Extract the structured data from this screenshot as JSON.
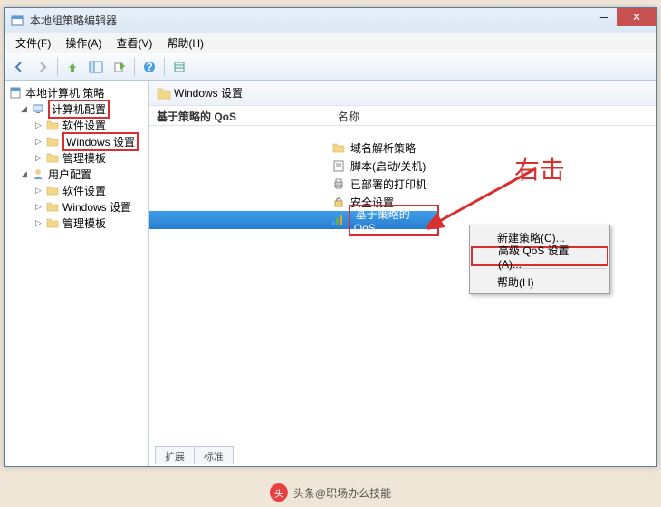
{
  "window": {
    "title": "本地组策略编辑器"
  },
  "menubar": [
    "文件(F)",
    "操作(A)",
    "查看(V)",
    "帮助(H)"
  ],
  "tree": {
    "root": "本地计算机 策略",
    "computer_config": "计算机配置",
    "software_settings": "软件设置",
    "windows_settings": "Windows 设置",
    "admin_templates": "管理模板",
    "user_config": "用户配置",
    "software_settings2": "软件设置",
    "windows_settings2": "Windows 设置",
    "admin_templates2": "管理模板"
  },
  "location": {
    "label": "Windows 设置"
  },
  "columns": {
    "section_title": "基于策略的 QoS",
    "name": "名称"
  },
  "list": [
    {
      "label": "域名解析策略",
      "icon": "folder"
    },
    {
      "label": "脚本(启动/关机)",
      "icon": "script"
    },
    {
      "label": "已部署的打印机",
      "icon": "printer"
    },
    {
      "label": "安全设置",
      "icon": "lock"
    },
    {
      "label": "基于策略的 QoS",
      "icon": "qos",
      "selected": true,
      "highlight": true
    }
  ],
  "context_menu": {
    "new_policy": "新建策略(C)...",
    "advanced": "高级 QoS 设置(A)...",
    "help": "帮助(H)"
  },
  "annotation": "右击",
  "tabs": {
    "extended": "扩展",
    "standard": "标准"
  },
  "watermark": "头条@职场办么技能"
}
